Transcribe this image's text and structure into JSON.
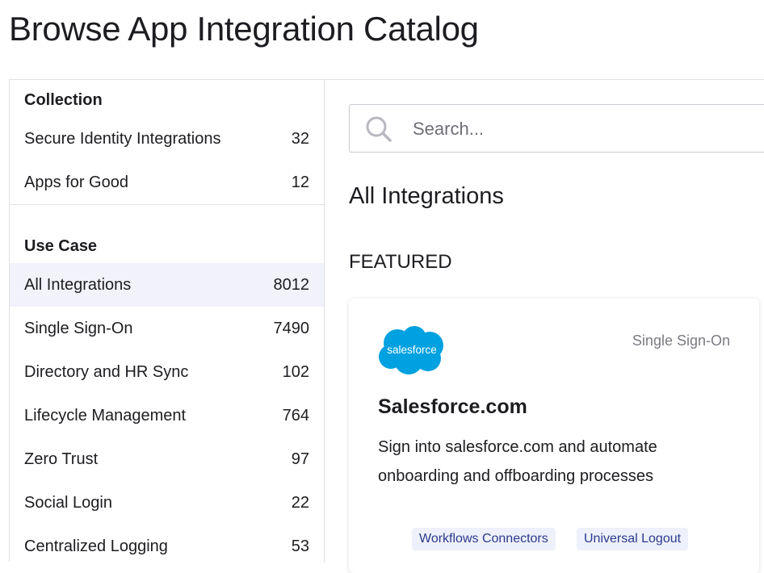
{
  "page": {
    "title": "Browse App Integration Catalog"
  },
  "sidebar": {
    "collection_title": "Collection",
    "collections": [
      {
        "label": "Secure Identity Integrations",
        "count": "32"
      },
      {
        "label": "Apps for Good",
        "count": "12"
      }
    ],
    "use_case_title": "Use Case",
    "use_cases": [
      {
        "label": "All Integrations",
        "count": "8012",
        "active": true
      },
      {
        "label": "Single Sign-On",
        "count": "7490"
      },
      {
        "label": "Directory and HR Sync",
        "count": "102"
      },
      {
        "label": "Lifecycle Management",
        "count": "764"
      },
      {
        "label": "Zero Trust",
        "count": "97"
      },
      {
        "label": "Social Login",
        "count": "22"
      },
      {
        "label": "Centralized Logging",
        "count": "53"
      }
    ]
  },
  "search": {
    "placeholder": "Search...",
    "value": "",
    "icon": "search-icon"
  },
  "main": {
    "heading": "All Integrations",
    "featured_label": "FEATURED"
  },
  "featured_card": {
    "logo_text": "salesforce",
    "logo_color": "#00a1e0",
    "category": "Single Sign-On",
    "title": "Salesforce.com",
    "description_line1": "Sign into salesforce.com and automate",
    "description_line2": "onboarding and offboarding processes",
    "tags": [
      "Workflows Connectors",
      "Universal Logout"
    ]
  },
  "colors": {
    "active_bg": "#f2f2fb",
    "tag_bg": "#eef0fb",
    "tag_text": "#2b3a8c",
    "border": "#e1e1e6"
  }
}
